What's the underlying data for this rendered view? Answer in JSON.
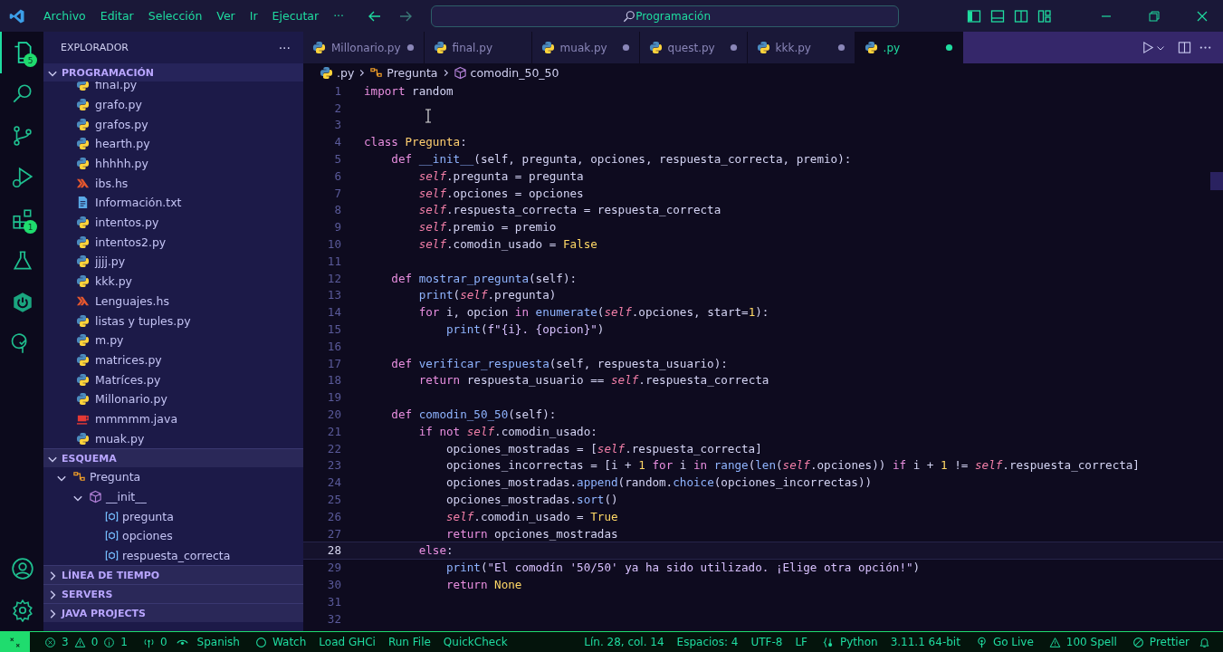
{
  "menu": [
    "Archivo",
    "Editar",
    "Selección",
    "Ver",
    "Ir",
    "Ejecutar",
    "···"
  ],
  "command_center": {
    "placeholder": "Programación"
  },
  "activity_badges": {
    "explorer": "5",
    "extensions": "1"
  },
  "sidebar": {
    "title": "EXPLORADOR",
    "more": "···",
    "folder": {
      "label": "PROGRAMACIÓN",
      "expanded": true
    },
    "files": [
      {
        "name": "final.py",
        "kind": "py"
      },
      {
        "name": "grafo.py",
        "kind": "py"
      },
      {
        "name": "grafos.py",
        "kind": "py"
      },
      {
        "name": "hearth.py",
        "kind": "py"
      },
      {
        "name": "hhhhh.py",
        "kind": "py"
      },
      {
        "name": "ibs.hs",
        "kind": "hs"
      },
      {
        "name": "Información.txt",
        "kind": "txt"
      },
      {
        "name": "intentos.py",
        "kind": "py"
      },
      {
        "name": "intentos2.py",
        "kind": "py"
      },
      {
        "name": "jjjj.py",
        "kind": "py"
      },
      {
        "name": "kkk.py",
        "kind": "py"
      },
      {
        "name": "Lenguajes.hs",
        "kind": "hs"
      },
      {
        "name": "listas y tuples.py",
        "kind": "py"
      },
      {
        "name": "m.py",
        "kind": "py"
      },
      {
        "name": "matrices.py",
        "kind": "py"
      },
      {
        "name": "Matríces.py",
        "kind": "py"
      },
      {
        "name": "Millonario.py",
        "kind": "py"
      },
      {
        "name": "mmmmm.java",
        "kind": "java"
      },
      {
        "name": "muak.py",
        "kind": "py"
      }
    ],
    "outline": {
      "label": "ESQUEMA",
      "expanded": true,
      "items": [
        {
          "name": "Pregunta",
          "kind": "class",
          "expanded": true,
          "children": [
            {
              "name": "__init__",
              "kind": "method",
              "expanded": true,
              "children": [
                {
                  "name": "pregunta",
                  "kind": "var"
                },
                {
                  "name": "opciones",
                  "kind": "var"
                },
                {
                  "name": "respuesta_correcta",
                  "kind": "var"
                }
              ]
            }
          ]
        }
      ]
    },
    "sections": [
      {
        "label": "LÍNEA DE TIEMPO",
        "expanded": false
      },
      {
        "label": "SERVERS",
        "expanded": false
      },
      {
        "label": "JAVA PROJECTS",
        "expanded": false
      }
    ]
  },
  "tabs": [
    {
      "label": "Millonario.py",
      "selected": false,
      "modified": true
    },
    {
      "label": "final.py",
      "selected": false,
      "modified": false
    },
    {
      "label": "muak.py",
      "selected": false,
      "modified": true
    },
    {
      "label": "quest.py",
      "selected": false,
      "modified": true
    },
    {
      "label": "kkk.py",
      "selected": false,
      "modified": true
    },
    {
      "label": ".py",
      "selected": true,
      "modified": true
    }
  ],
  "breadcrumbs": [
    {
      "label": ".py",
      "kind": "file"
    },
    {
      "label": "Pregunta",
      "kind": "class"
    },
    {
      "label": "comodin_50_50",
      "kind": "method"
    }
  ],
  "code": [
    {
      "n": "1",
      "current": false,
      "tokens": [
        {
          "t": "import ",
          "kind": "kw"
        },
        {
          "t": "random",
          "kind": "p"
        }
      ]
    },
    {
      "n": "2",
      "current": false
    },
    {
      "n": "3",
      "current": false
    },
    {
      "n": "4",
      "current": false,
      "tokens": [
        {
          "t": "class ",
          "kind": "kw"
        },
        {
          "t": "Pregunta",
          "kind": "cls"
        },
        {
          "t": ":",
          "kind": "p"
        }
      ]
    },
    {
      "n": "5",
      "current": false,
      "tokens": [
        {
          "t": "    def ",
          "kind": "kw"
        },
        {
          "t": "__init__",
          "kind": "fn"
        },
        {
          "t": "(self, pregunta, opciones, respuesta_correcta, premio):",
          "kind": "p"
        }
      ]
    },
    {
      "n": "6",
      "current": false,
      "tokens": [
        {
          "t": "        self",
          "kind": "self"
        },
        {
          "t": ".pregunta = pregunta",
          "kind": "p"
        }
      ]
    },
    {
      "n": "7",
      "current": false,
      "tokens": [
        {
          "t": "        self",
          "kind": "self"
        },
        {
          "t": ".opciones = opciones",
          "kind": "p"
        }
      ]
    },
    {
      "n": "8",
      "current": false,
      "tokens": [
        {
          "t": "        self",
          "kind": "self"
        },
        {
          "t": ".respuesta_correcta = respuesta_correcta",
          "kind": "p"
        }
      ]
    },
    {
      "n": "9",
      "current": false,
      "tokens": [
        {
          "t": "        self",
          "kind": "self"
        },
        {
          "t": ".premio = premio",
          "kind": "p"
        }
      ]
    },
    {
      "n": "10",
      "current": false,
      "tokens": [
        {
          "t": "        self",
          "kind": "self"
        },
        {
          "t": ".comodin_usado = ",
          "kind": "p"
        },
        {
          "t": "False",
          "kind": "c"
        }
      ]
    },
    {
      "n": "11",
      "current": false
    },
    {
      "n": "12",
      "current": false,
      "tokens": [
        {
          "t": "    def ",
          "kind": "kw"
        },
        {
          "t": "mostrar_pregunta",
          "kind": "fn"
        },
        {
          "t": "(self):",
          "kind": "p"
        }
      ]
    },
    {
      "n": "13",
      "current": false,
      "tokens": [
        {
          "t": "        print",
          "kind": "fn"
        },
        {
          "t": "(",
          "kind": "p"
        },
        {
          "t": "self",
          "kind": "self"
        },
        {
          "t": ".pregunta)",
          "kind": "p"
        }
      ]
    },
    {
      "n": "14",
      "current": false,
      "tokens": [
        {
          "t": "        for ",
          "kind": "kw"
        },
        {
          "t": "i, opcion ",
          "kind": "p"
        },
        {
          "t": "in ",
          "kind": "kw"
        },
        {
          "t": "enumerate",
          "kind": "fn"
        },
        {
          "t": "(",
          "kind": "p"
        },
        {
          "t": "self",
          "kind": "self"
        },
        {
          "t": ".opciones, start=",
          "kind": "p"
        },
        {
          "t": "1",
          "kind": "c"
        },
        {
          "t": "):",
          "kind": "p"
        }
      ]
    },
    {
      "n": "15",
      "current": false,
      "tokens": [
        {
          "t": "            print",
          "kind": "fn"
        },
        {
          "t": "(",
          "kind": "p"
        },
        {
          "t": "f\"{i}. {opcion}\"",
          "kind": "str"
        },
        {
          "t": ")",
          "kind": "p"
        }
      ]
    },
    {
      "n": "16",
      "current": false
    },
    {
      "n": "17",
      "current": false,
      "tokens": [
        {
          "t": "    def ",
          "kind": "kw"
        },
        {
          "t": "verificar_respuesta",
          "kind": "fn"
        },
        {
          "t": "(self, respuesta_usuario):",
          "kind": "p"
        }
      ]
    },
    {
      "n": "18",
      "current": false,
      "tokens": [
        {
          "t": "        return ",
          "kind": "kw"
        },
        {
          "t": "respuesta_usuario == ",
          "kind": "p"
        },
        {
          "t": "self",
          "kind": "self"
        },
        {
          "t": ".respuesta_correcta",
          "kind": "p"
        }
      ]
    },
    {
      "n": "19",
      "current": false
    },
    {
      "n": "20",
      "current": false,
      "tokens": [
        {
          "t": "    def ",
          "kind": "kw"
        },
        {
          "t": "comodin_50_50",
          "kind": "fn"
        },
        {
          "t": "(self):",
          "kind": "p"
        }
      ]
    },
    {
      "n": "21",
      "current": false,
      "tokens": [
        {
          "t": "        if not ",
          "kind": "kw"
        },
        {
          "t": "self",
          "kind": "self"
        },
        {
          "t": ".comodin_usado:",
          "kind": "p"
        }
      ]
    },
    {
      "n": "22",
      "current": false,
      "tokens": [
        {
          "t": "            opciones_mostradas = [",
          "kind": "p"
        },
        {
          "t": "self",
          "kind": "self"
        },
        {
          "t": ".respuesta_correcta]",
          "kind": "p"
        }
      ]
    },
    {
      "n": "23",
      "current": false,
      "tokens": [
        {
          "t": "            opciones_incorrectas = [i + ",
          "kind": "p"
        },
        {
          "t": "1",
          "kind": "c"
        },
        {
          "t": " for ",
          "kind": "kw"
        },
        {
          "t": "i ",
          "kind": "p"
        },
        {
          "t": "in ",
          "kind": "kw"
        },
        {
          "t": "range",
          "kind": "fn"
        },
        {
          "t": "(",
          "kind": "p"
        },
        {
          "t": "len",
          "kind": "fn"
        },
        {
          "t": "(",
          "kind": "p"
        },
        {
          "t": "self",
          "kind": "self"
        },
        {
          "t": ".opciones)) ",
          "kind": "p"
        },
        {
          "t": "if ",
          "kind": "kw"
        },
        {
          "t": "i + ",
          "kind": "p"
        },
        {
          "t": "1",
          "kind": "c"
        },
        {
          "t": " != ",
          "kind": "p"
        },
        {
          "t": "self",
          "kind": "self"
        },
        {
          "t": ".respuesta_correcta]",
          "kind": "p"
        }
      ]
    },
    {
      "n": "24",
      "current": false,
      "tokens": [
        {
          "t": "            opciones_mostradas.",
          "kind": "p"
        },
        {
          "t": "append",
          "kind": "fn"
        },
        {
          "t": "(random.",
          "kind": "p"
        },
        {
          "t": "choice",
          "kind": "fn"
        },
        {
          "t": "(opciones_incorrectas))",
          "kind": "p"
        }
      ]
    },
    {
      "n": "25",
      "current": false,
      "tokens": [
        {
          "t": "            opciones_mostradas.",
          "kind": "p"
        },
        {
          "t": "sort",
          "kind": "fn"
        },
        {
          "t": "()",
          "kind": "p"
        }
      ]
    },
    {
      "n": "26",
      "current": false,
      "tokens": [
        {
          "t": "            self",
          "kind": "self"
        },
        {
          "t": ".comodin_usado = ",
          "kind": "p"
        },
        {
          "t": "True",
          "kind": "c"
        }
      ]
    },
    {
      "n": "27",
      "current": false,
      "tokens": [
        {
          "t": "            return ",
          "kind": "kw"
        },
        {
          "t": "opciones_mostradas",
          "kind": "p"
        }
      ]
    },
    {
      "n": "28",
      "current": true,
      "tokens": [
        {
          "t": "        else",
          "kind": "kw"
        },
        {
          "t": ":",
          "kind": "p"
        }
      ]
    },
    {
      "n": "29",
      "current": false,
      "tokens": [
        {
          "t": "            print",
          "kind": "fn"
        },
        {
          "t": "(",
          "kind": "p"
        },
        {
          "t": "\"El comodín '50/50' ya ha sido utilizado. ¡Elige otra opción!\"",
          "kind": "str"
        },
        {
          "t": ")",
          "kind": "p"
        }
      ]
    },
    {
      "n": "30",
      "current": false,
      "tokens": [
        {
          "t": "            return ",
          "kind": "kw"
        },
        {
          "t": "None",
          "kind": "c"
        }
      ]
    },
    {
      "n": "31",
      "current": false
    },
    {
      "n": "32",
      "current": false
    }
  ],
  "status_bar": {
    "left": [
      {
        "kind": "errors",
        "errors": "3",
        "warnings": "0",
        "infos": "1"
      },
      {
        "kind": "ports",
        "text": "0"
      },
      {
        "kind": "eye"
      },
      {
        "kind": "text",
        "text": "Spanish"
      },
      {
        "kind": "circle",
        "text": "Watch"
      },
      {
        "kind": "text",
        "text": "Load GHCi"
      },
      {
        "kind": "text",
        "text": "Run File"
      },
      {
        "kind": "text",
        "text": "QuickCheck"
      }
    ],
    "right": [
      {
        "kind": "text",
        "text": "Lín. 28, col. 14"
      },
      {
        "kind": "text",
        "text": "Espacios: 4"
      },
      {
        "kind": "text",
        "text": "UTF-8"
      },
      {
        "kind": "text",
        "text": "LF"
      },
      {
        "kind": "braces",
        "text": "Python"
      },
      {
        "kind": "text",
        "text": "3.11.1 64-bit"
      },
      {
        "kind": "live",
        "text": "Go Live"
      },
      {
        "kind": "warn",
        "text": "100 Spell"
      },
      {
        "kind": "noentry",
        "text": "Prettier"
      },
      {
        "kind": "bell"
      }
    ]
  }
}
